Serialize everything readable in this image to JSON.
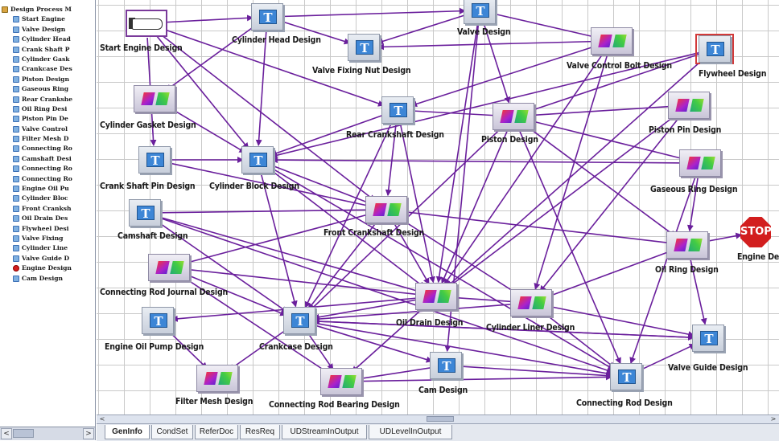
{
  "tree": {
    "root_label": "Design Process M",
    "items": [
      "Start Engine",
      "Valve Design",
      "Cylinder Head",
      "Crank Shaft P",
      "Cylinder Gask",
      "Crankcase Des",
      "Piston Design",
      "Gaseous Ring",
      "Rear Crankshe",
      "Oil Ring Desi",
      "Piston Pin De",
      "Valve Control",
      "Filter Mesh D",
      "Connecting Ro",
      "Camshaft Desi",
      "Connecting Ro",
      "Connecting Ro",
      "Engine Oil Pu",
      "Cylinder Bloc",
      "Front Cranksh",
      "Oil Drain Des",
      "Flywheel Desi",
      "Valve Fixing",
      "Cylinder Line",
      "Valve Guide D",
      "Engine Design",
      "Cam Design"
    ]
  },
  "nodes": {
    "start": {
      "label": "Start Engine Design"
    },
    "head": {
      "label": "Cylinder Head Design"
    },
    "valve": {
      "label": "Valve Design"
    },
    "fixnut": {
      "label": "Valve Fixing Nut Design"
    },
    "ctrlbolt": {
      "label": "Valve Control Bolt Design"
    },
    "flywheel": {
      "label": "Flywheel Design"
    },
    "gasket": {
      "label": "Cylinder Gasket Design"
    },
    "rear": {
      "label": "Rear Crankshaft Design"
    },
    "piston": {
      "label": "Piston Design"
    },
    "pin": {
      "label": "Piston Pin Design"
    },
    "cpin": {
      "label": "Crank Shaft Pin Design"
    },
    "block": {
      "label": "Cylinder Block Design"
    },
    "gas": {
      "label": "Gaseous Ring Design"
    },
    "cam": {
      "label": "Camshaft Design"
    },
    "front": {
      "label": "Front Crankshaft Design"
    },
    "oilring": {
      "label": "Oil Ring Design"
    },
    "engine": {
      "label": "Engine Design",
      "stop_text": "STOP"
    },
    "journal": {
      "label": "Connecting Rod Journal Design"
    },
    "drain": {
      "label": "Oil Drain Design"
    },
    "liner": {
      "label": "Cylinder Liner Design"
    },
    "pump": {
      "label": "Engine Oil Pump Design"
    },
    "crankcase": {
      "label": "Crankcase Design"
    },
    "guide": {
      "label": "Valve Guide Design"
    },
    "filter": {
      "label": "Filter Mesh Design"
    },
    "bearing": {
      "label": "Connecting Rod Bearing Design"
    },
    "camd": {
      "label": "Cam Design"
    },
    "rod": {
      "label": "Connecting Rod Design"
    }
  },
  "tabs": [
    "GenInfo",
    "CondSet",
    "ReferDoc",
    "ResReq",
    "UDStreamInOutput",
    "UDLevelInOutput"
  ],
  "active_tab": "GenInfo",
  "colors": {
    "edge": "#6a1f9c",
    "grid": "#c9c9c9",
    "icon_blue": "#3d86d6",
    "stop_red": "#d21e1e"
  },
  "icons": {
    "text_node": "text-document-icon",
    "assembly_node": "assembly-icon",
    "start_node": "pointing-hand-icon",
    "end_node": "stop-sign-icon"
  }
}
